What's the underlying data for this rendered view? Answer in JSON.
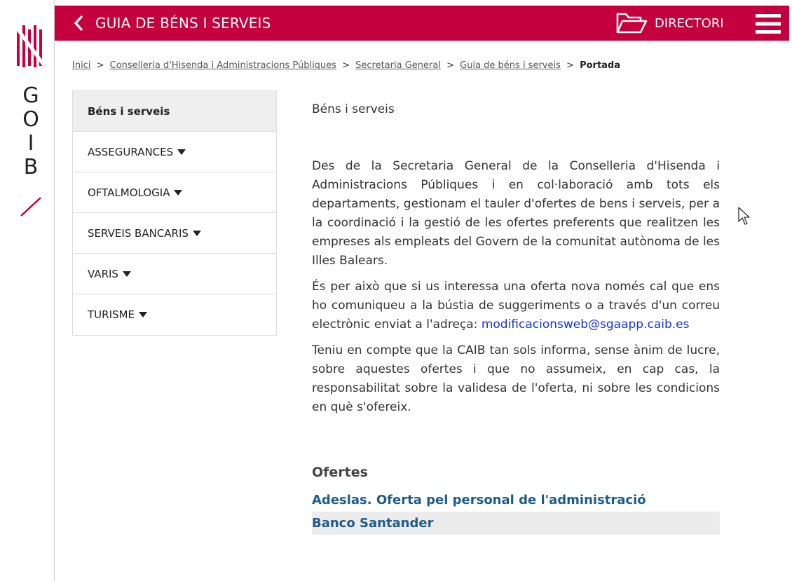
{
  "brand": {
    "letters": [
      "G",
      "O",
      "I",
      "B"
    ],
    "colors": {
      "red": "#c5003e"
    }
  },
  "header": {
    "back_icon": "chevron-left-icon",
    "title": "GUIA DE BÉNS I SERVEIS",
    "directori_label": "DIRECTORI",
    "directori_icon": "folder-open-icon",
    "menu_icon": "hamburger-menu-icon",
    "background": "#c5003e"
  },
  "breadcrumb": {
    "items": [
      "Inici",
      "Conselleria d'Hisenda i Administracions Públiques",
      "Secretaria General",
      "Guia de béns i serveis"
    ],
    "separator": ">",
    "current": "Portada"
  },
  "sidebar": {
    "items": [
      {
        "label": "Béns i serveis",
        "active": true
      },
      {
        "label": "ASSEGURANCES",
        "caret": true
      },
      {
        "label": "OFTALMOLOGIA",
        "caret": true
      },
      {
        "label": "SERVEIS BANCARIS",
        "caret": true
      },
      {
        "label": "VARIS",
        "caret": true
      },
      {
        "label": "TURISME",
        "caret": true
      }
    ]
  },
  "main": {
    "section_title": "Béns i serveis",
    "paragraph_1": "Des de la Secretaria General de la Conselleria d'Hisenda i Administracions Públiques i en col·laboració amb tots els departaments, gestionam el tauler d'ofertes de bens i serveis, per a la coordinació i la gestió de les ofertes preferents que realitzen les empreses als empleats del Govern de la comunitat autònoma de les Illes Balears.",
    "paragraph_2_text": "És per això que si us interessa una oferta nova només cal que ens ho comuniqueu a la bústia de suggeriments o a través d'un correu electrònic enviat a l'adreça:",
    "paragraph_2_email": "modificacionsweb@sgaapp.caib.es",
    "paragraph_3": "Teniu en compte que la CAIB tan sols informa, sense ànim de lucre, sobre aquestes ofertes i que no assumeix, en cap cas, la responsabilitat sobre la validesa de l'oferta, ni sobre les condicions en què s'ofereix.",
    "ofertes_heading": "Ofertes",
    "offers": [
      "Adeslas. Oferta pel personal de l'administració",
      "Banco Santander"
    ]
  }
}
